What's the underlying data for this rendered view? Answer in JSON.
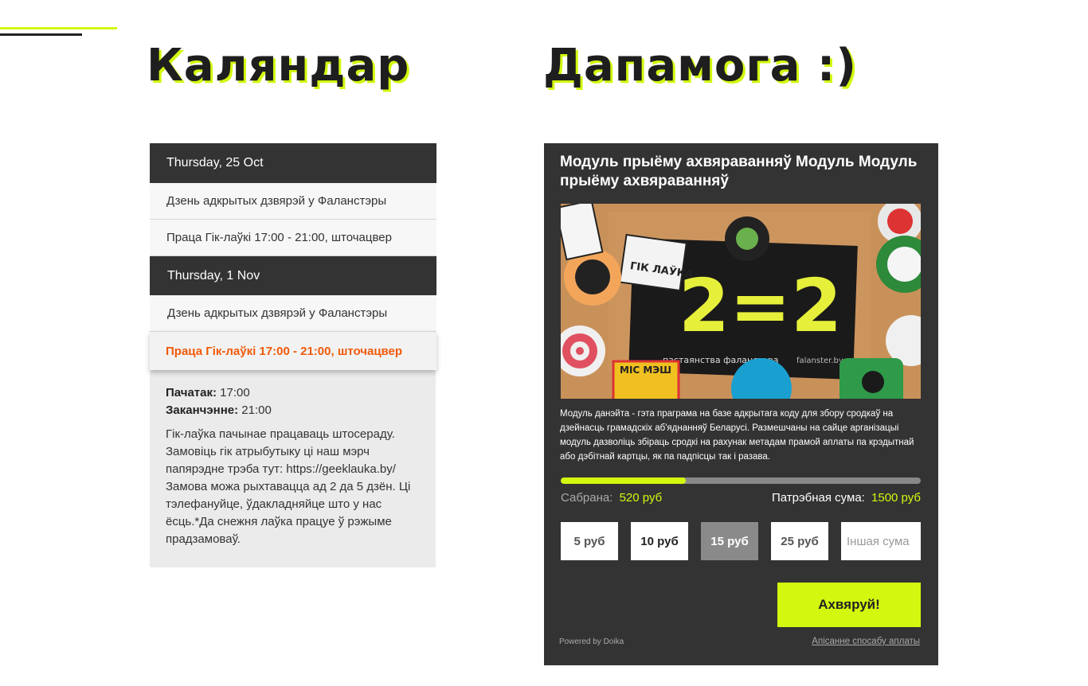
{
  "headings": {
    "calendar": "Каляндар",
    "help": "Дапамога :)"
  },
  "calendar": {
    "days": [
      {
        "date": "Thursday, 25 Oct",
        "events": [
          "Дзень адкрытых дзвярэй у Фаланстэры",
          "Праца Гік-лаўкі 17:00 - 21:00, шточацвер"
        ]
      },
      {
        "date": "Thursday, 1 Nov",
        "events": [
          "Дзень адкрытых дзвярэй у Фаланстэры",
          "Праца Гік-лаўкі 17:00 - 21:00, шточацвер"
        ]
      }
    ],
    "details": {
      "start_label": "Пачатак:",
      "start_value": "17:00",
      "end_label": "Заканчэнне:",
      "end_value": "21:00",
      "description": "Гік-лаўка пачынае працаваць штосераду. Замовіць гік атрыбутыку ці наш мэрч папярэдне трэба тут: https://geeklauka.by/ Замова можа рыхтавацца ад 2 да 5 дзён. Ці тэлефануйце, ўдакладняйце што у нас ёсць.*Да снежня лаўка працуе ў рэжыме прадзамоваў."
    }
  },
  "donation": {
    "title": "Модуль прыёму ахвяраванняў Модуль Модуль прыёму ахвяраванняў",
    "image": {
      "sign_text": "2=2",
      "sign_caption": "пастаянства фаланстэра",
      "sign_url": "falanster.by",
      "sticker_text": "ГІК ЛАЎКА",
      "sticker_mis": "МІС МЭШ"
    },
    "description": "Модуль данэйта - гэта праграма на базе адкрытага коду для збору сродкаў на дзейнасць грамадскіх аб'яднанняў Беларусі. Размешчаны на сайце арганізацыі модуль дазволіць збіраць сродкі на рахунак метадам прамой аплаты па крэдытнай або дэбітнай картцы, як па падпісцы так і разава.",
    "progress": 0.3467,
    "raised_label": "Сабрана:",
    "raised_value": "520 руб",
    "needed_label": "Патрэбная сума:",
    "needed_value": "1500 руб",
    "amounts": [
      "5 руб",
      "10 руб",
      "15 руб",
      "25 руб"
    ],
    "selected_amount": "15 руб",
    "custom_placeholder": "Іншая сума",
    "button": "Ахвяруй!",
    "powered_by": "Powered by Doika",
    "payment_link": "Апісанне спосабу аплаты"
  },
  "colors": {
    "accent": "#d4f70f",
    "dark": "#333333",
    "highlight": "#f05a0a"
  }
}
